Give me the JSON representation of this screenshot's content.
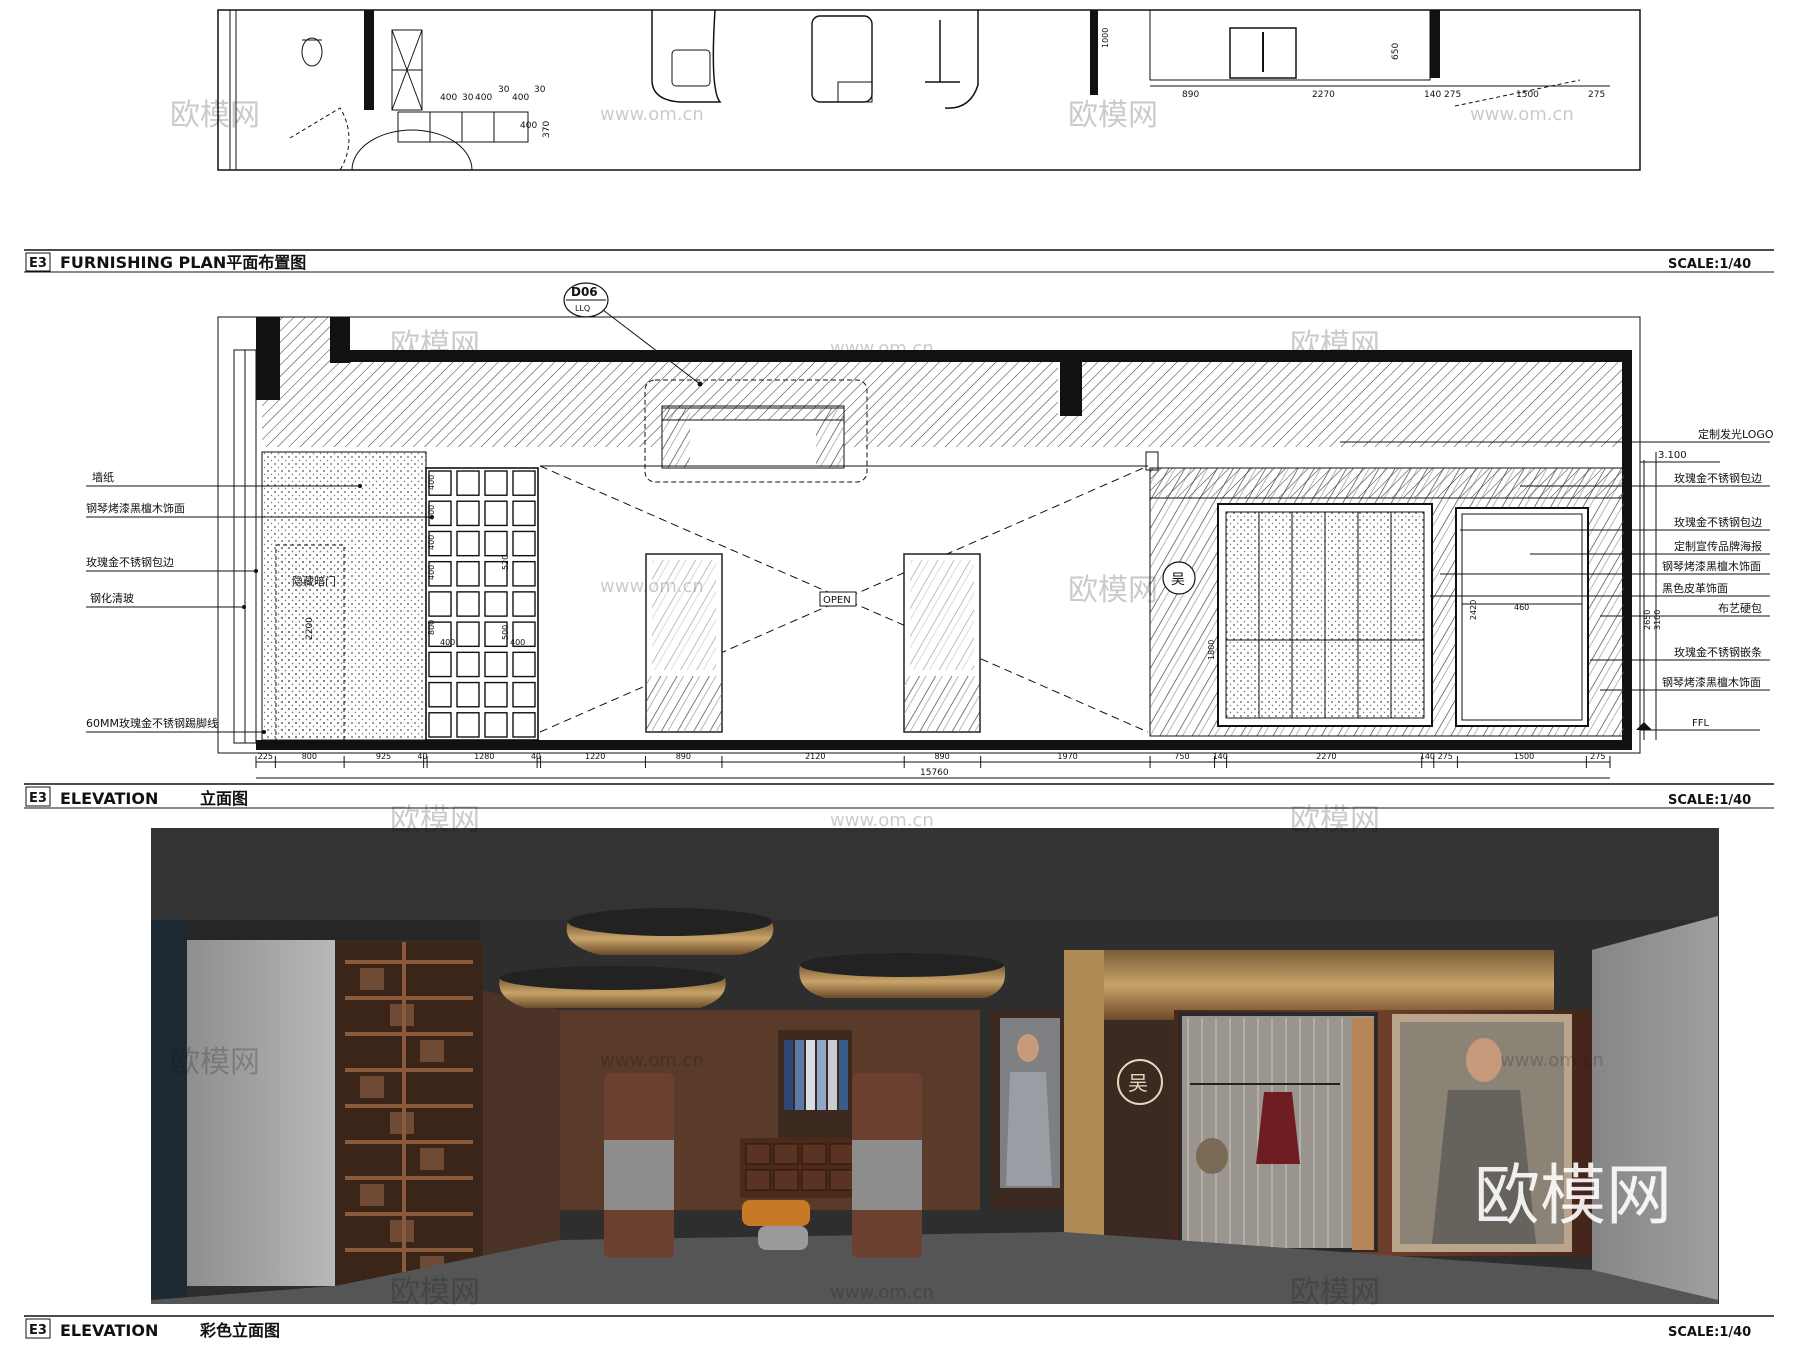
{
  "sections": {
    "plan": {
      "tag": "E3",
      "title": "FURNISHING PLAN平面布置图",
      "scale": "SCALE:1/40"
    },
    "elevation": {
      "tag": "E3",
      "title_en": "ELEVATION",
      "title_cn": "立面图",
      "scale": "SCALE:1/40"
    },
    "color_elevation": {
      "tag": "E3",
      "title_en": "ELEVATION",
      "title_cn": "彩色立面图",
      "scale": "SCALE:1/40"
    }
  },
  "plan_dims": {
    "left": [
      "400",
      "30",
      "400",
      "30",
      "400",
      "30",
      "400"
    ],
    "right": [
      "890",
      "2270",
      "140",
      "275",
      "1500",
      "275"
    ],
    "vertical": [
      "370",
      "650"
    ]
  },
  "elevation_marks": {
    "detail_tag": "D06",
    "detail_sub": "LLQ",
    "open_label": "OPEN",
    "height_level": "3.100",
    "ffl_label": "FFL",
    "door_label": "隐藏暗门",
    "dim_door_h": "2200",
    "dim_2420": "2420",
    "dim_1800": "1800",
    "dim_460": "460",
    "dim_3100": "3100",
    "dim_2650": "2650"
  },
  "left_notes": [
    "墙纸",
    "钢琴烤漆黑檀木饰面",
    "玫瑰金不锈钢包边",
    "钢化清玻",
    "60MM玫瑰金不锈钢踢脚线"
  ],
  "right_notes": [
    "定制发光LOGO",
    "玫瑰金不锈钢包边",
    "玫瑰金不锈钢包边",
    "定制宣传品牌海报",
    "钢琴烤漆黑檀木饰面",
    "黑色皮革饰面",
    "布艺硬包",
    "玫瑰金不锈钢嵌条",
    "钢琴烤漆黑檀木饰面"
  ],
  "shelf_dims": [
    "400",
    "400",
    "400",
    "400",
    "320",
    "520",
    "800",
    "500",
    "400",
    "400"
  ],
  "bottom_dims": [
    "225",
    "800",
    "925",
    "40",
    "1280",
    "40",
    "1220",
    "890",
    "2120",
    "890",
    "1970",
    "750",
    "140",
    "2270",
    "140",
    "275",
    "1500",
    "275"
  ],
  "total_dim": "15760",
  "watermark_text": [
    "欧模网",
    "www.om.cn"
  ],
  "big_watermark": "欧模网",
  "logo_char": "吴",
  "colors": {
    "line": "#111111",
    "gold": "#b08a55",
    "wood": "#5a3222",
    "dark": "#2c2c2c",
    "floor": "#4a4a4a"
  }
}
